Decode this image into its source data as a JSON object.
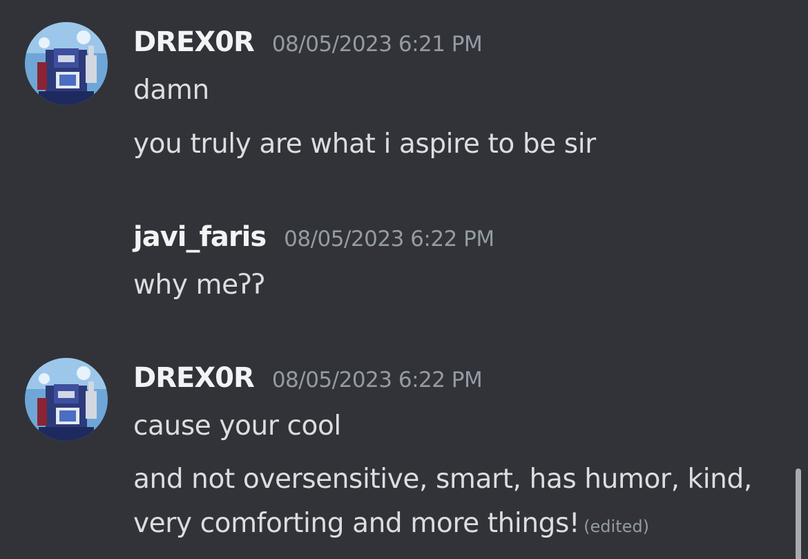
{
  "messages": [
    {
      "username": "DREX0R",
      "timestamp": "08/05/2023 6:21 PM",
      "lines": [
        "damn",
        "you truly are what i aspire to be sir"
      ]
    },
    {
      "username": "javi_faris",
      "timestamp": "08/05/2023 6:22 PM",
      "lines": [
        "why meʔʔ"
      ]
    },
    {
      "username": "DREX0R",
      "timestamp": "08/05/2023 6:22 PM",
      "lines": [
        "cause your cool",
        "and not oversensitive, smart, has humor, kind, very comforting and more things!"
      ],
      "edited_label": "(edited)"
    }
  ],
  "avatar_icon": "robot-avatar-icon",
  "colors": {
    "background": "#313338",
    "username": "#f2f3f5",
    "message_text": "#dbdee1",
    "timestamp": "#949ba4",
    "scrollbar": "#a8abb0"
  }
}
